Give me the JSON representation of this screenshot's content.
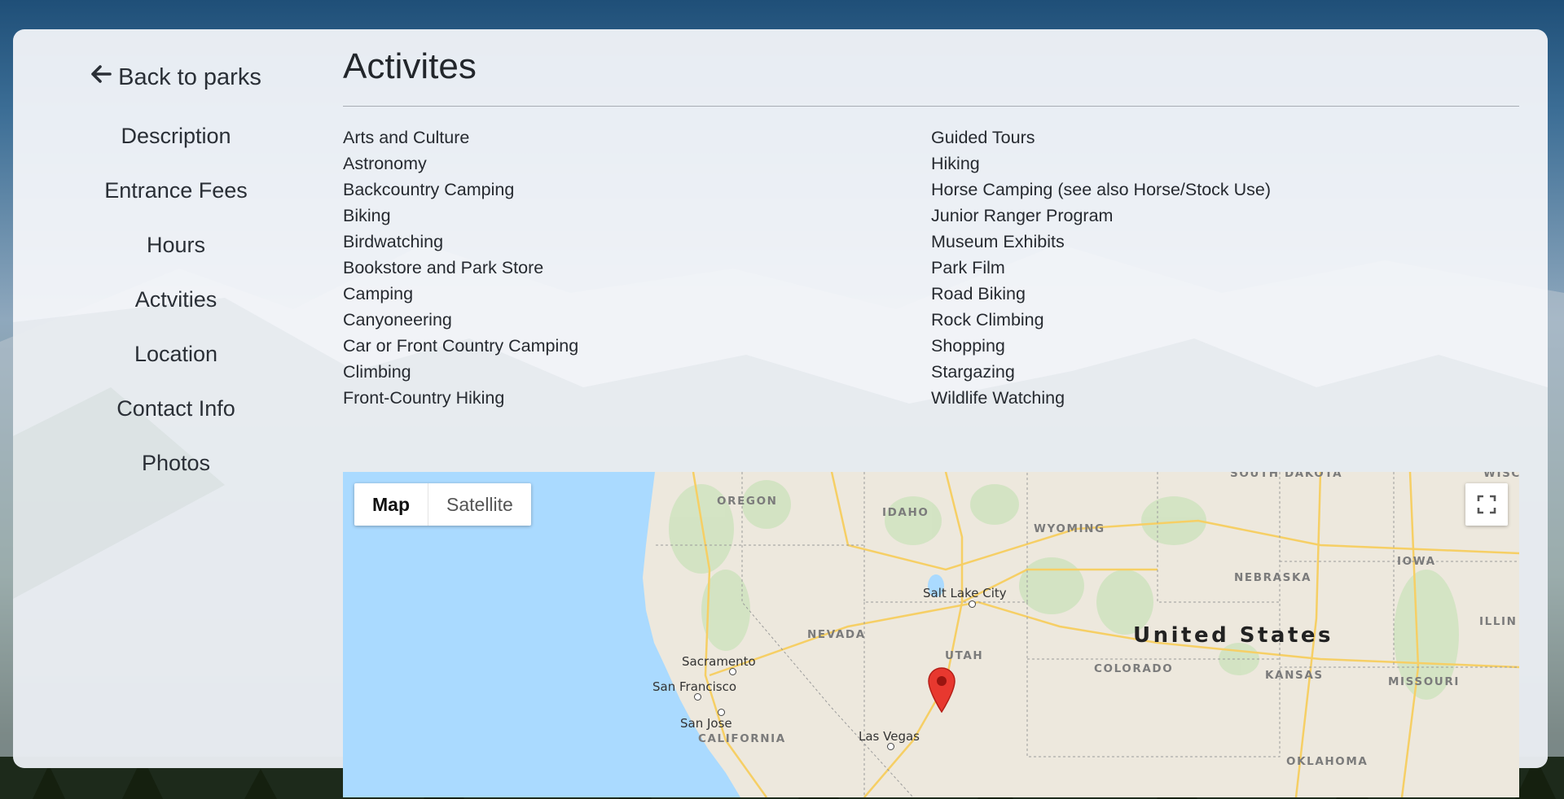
{
  "sidebar": {
    "back_label": "Back to parks",
    "items": [
      {
        "label": "Description"
      },
      {
        "label": "Entrance Fees"
      },
      {
        "label": "Hours"
      },
      {
        "label": "Actvities"
      },
      {
        "label": "Location"
      },
      {
        "label": "Contact Info"
      },
      {
        "label": "Photos"
      }
    ]
  },
  "main": {
    "title": "Activites",
    "activities_left": [
      "Arts and Culture",
      "Astronomy",
      "Backcountry Camping",
      "Biking",
      "Birdwatching",
      "Bookstore and Park Store",
      "Camping",
      "Canyoneering",
      "Car or Front Country Camping",
      "Climbing",
      "Front-Country Hiking"
    ],
    "activities_right": [
      "Guided Tours",
      "Hiking",
      "Horse Camping (see also Horse/Stock Use)",
      "Junior Ranger Program",
      "Museum Exhibits",
      "Park Film",
      "Road Biking",
      "Rock Climbing",
      "Shopping",
      "Stargazing",
      "Wildlife Watching"
    ]
  },
  "map": {
    "type_map": "Map",
    "type_satellite": "Satellite",
    "country": "United States",
    "states": {
      "south_dakota": "SOUTH DAKOTA",
      "oregon": "OREGON",
      "idaho": "IDAHO",
      "wyoming": "WYOMING",
      "nebraska": "NEBRASKA",
      "iowa": "IOWA",
      "nevada": "NEVADA",
      "utah": "UTAH",
      "colorado": "COLORADO",
      "kansas": "KANSAS",
      "missouri": "MISSOURI",
      "illinois": "ILLIN",
      "california": "CALIFORNIA",
      "oklahoma": "OKLAHOMA",
      "wisconsin": "WISCO"
    },
    "cities": {
      "salt_lake_city": "Salt Lake City",
      "sacramento": "Sacramento",
      "san_francisco": "San Francisco",
      "san_jose": "San Jose",
      "las_vegas": "Las Vegas"
    },
    "colors": {
      "water": "#aadaff",
      "land": "#ede8dd",
      "roads": "#f6cf65",
      "marker": "#e8382f"
    }
  }
}
